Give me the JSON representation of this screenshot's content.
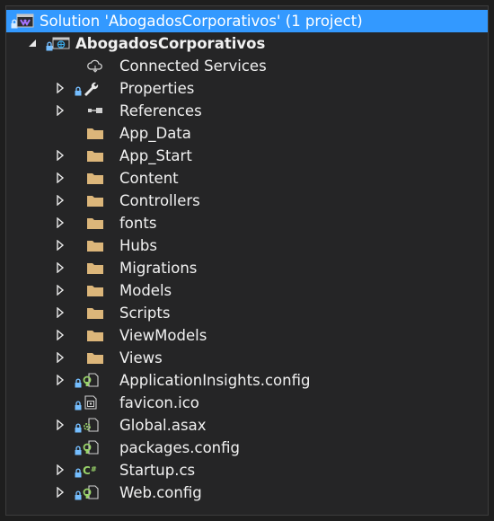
{
  "tree": {
    "solution_label": "Solution 'AbogadosCorporativos' (1 project)",
    "project_label": "AbogadosCorporativos",
    "items": [
      {
        "label": "Connected Services",
        "icon": "cloud-connection-icon",
        "expander": "none",
        "lock": false
      },
      {
        "label": "Properties",
        "icon": "wrench-icon",
        "expander": "collapsed",
        "lock": true
      },
      {
        "label": "References",
        "icon": "references-icon",
        "expander": "collapsed",
        "lock": false
      },
      {
        "label": "App_Data",
        "icon": "folder-icon",
        "expander": "none",
        "lock": false
      },
      {
        "label": "App_Start",
        "icon": "folder-icon",
        "expander": "collapsed",
        "lock": false
      },
      {
        "label": "Content",
        "icon": "folder-icon",
        "expander": "collapsed",
        "lock": false
      },
      {
        "label": "Controllers",
        "icon": "folder-icon",
        "expander": "collapsed",
        "lock": false
      },
      {
        "label": "fonts",
        "icon": "folder-icon",
        "expander": "collapsed",
        "lock": false
      },
      {
        "label": "Hubs",
        "icon": "folder-icon",
        "expander": "collapsed",
        "lock": false
      },
      {
        "label": "Migrations",
        "icon": "folder-icon",
        "expander": "collapsed",
        "lock": false
      },
      {
        "label": "Models",
        "icon": "folder-icon",
        "expander": "collapsed",
        "lock": false
      },
      {
        "label": "Scripts",
        "icon": "folder-icon",
        "expander": "collapsed",
        "lock": false
      },
      {
        "label": "ViewModels",
        "icon": "folder-icon",
        "expander": "collapsed",
        "lock": false
      },
      {
        "label": "Views",
        "icon": "folder-icon",
        "expander": "collapsed",
        "lock": false
      },
      {
        "label": "ApplicationInsights.config",
        "icon": "config-file-icon",
        "expander": "collapsed",
        "lock": true
      },
      {
        "label": "favicon.ico",
        "icon": "image-file-icon",
        "expander": "none",
        "lock": true
      },
      {
        "label": "Global.asax",
        "icon": "asax-file-icon",
        "expander": "collapsed",
        "lock": true
      },
      {
        "label": "packages.config",
        "icon": "config-file-icon",
        "expander": "none",
        "lock": true
      },
      {
        "label": "Startup.cs",
        "icon": "csharp-file-icon",
        "expander": "collapsed",
        "lock": true
      },
      {
        "label": "Web.config",
        "icon": "config-file-icon",
        "expander": "collapsed",
        "lock": true
      }
    ]
  },
  "colors": {
    "background": "#252526",
    "selection": "#3399ff",
    "folder": "#dcb67a",
    "lock": "#75beff",
    "text": "#f1f1f1"
  }
}
